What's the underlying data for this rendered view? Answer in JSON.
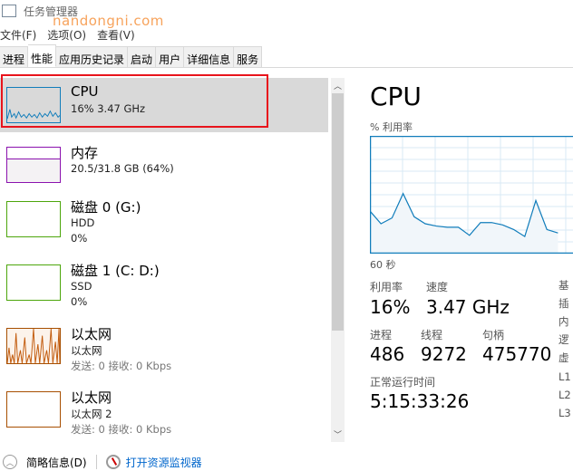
{
  "window": {
    "title": "任务管理器",
    "watermark": "nandongni.com"
  },
  "menu": [
    "文件(F)",
    "选项(O)",
    "查看(V)"
  ],
  "tabs": [
    "进程",
    "性能",
    "应用历史记录",
    "启动",
    "用户",
    "详细信息",
    "服务"
  ],
  "active_tab": "性能",
  "sidebar": {
    "items": [
      {
        "name": "CPU",
        "line2": "16% 3.47 GHz",
        "color": "#117dbb",
        "selected": true
      },
      {
        "name": "内存",
        "line2": "20.5/31.8 GB (64%)",
        "color": "#8b12ae"
      },
      {
        "name": "磁盘 0 (G:)",
        "line2": "HDD",
        "line3": "0%",
        "color": "#4da60c"
      },
      {
        "name": "磁盘 1 (C: D:)",
        "line2": "SSD",
        "line3": "0%",
        "color": "#4da60c"
      },
      {
        "name": "以太网",
        "line2": "以太网",
        "line3": "发送: 0 接收: 0 Kbps",
        "color": "#a74f01"
      },
      {
        "name": "以太网",
        "line2": "以太网 2",
        "line3": "发送: 0 接收: 0 Kbps",
        "color": "#a74f01"
      }
    ]
  },
  "detail": {
    "title": "CPU",
    "graph_label": "% 利用率",
    "time_label": "60 秒",
    "chart_data": {
      "type": "area",
      "ylim": [
        0,
        100
      ],
      "values": [
        36,
        25,
        30,
        51,
        31,
        25,
        23,
        22,
        22,
        15,
        26,
        26,
        24,
        20,
        14,
        45,
        20,
        17
      ],
      "color": "#117dbb"
    },
    "stats": {
      "util_label": "利用率",
      "util": "16%",
      "speed_label": "速度",
      "speed": "3.47 GHz",
      "proc_label": "进程",
      "proc": "486",
      "thread_label": "线程",
      "thread": "9272",
      "handle_label": "句柄",
      "handle": "475770",
      "uptime_label": "正常运行时间",
      "uptime": "5:15:33:26"
    },
    "right_labels": [
      "基",
      "插",
      "内",
      "逻",
      "虚",
      "L1",
      "L2",
      "L3"
    ]
  },
  "footer": {
    "summary": "简略信息(D)",
    "resmon": "打开资源监视器"
  }
}
